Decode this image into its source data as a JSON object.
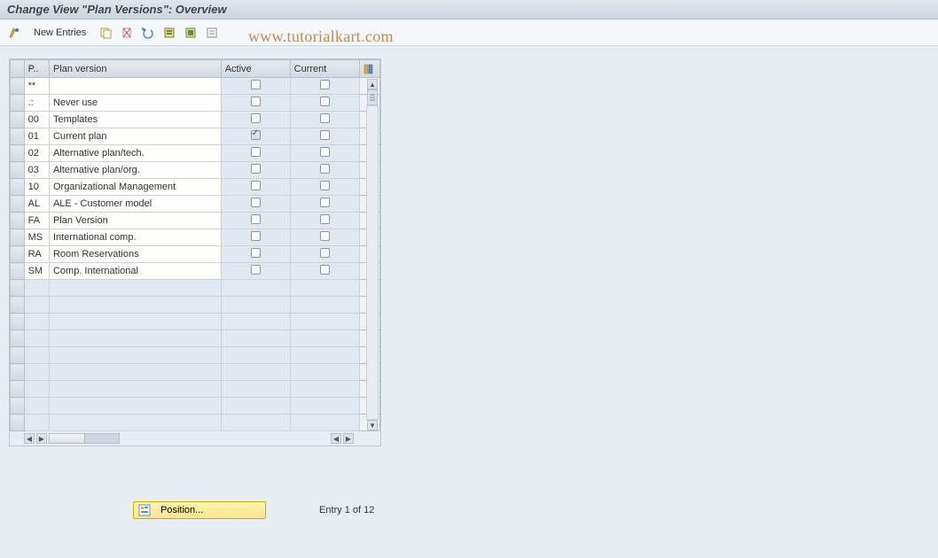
{
  "title": "Change View \"Plan Versions\": Overview",
  "toolbar": {
    "new_entries": "New Entries"
  },
  "watermark": "www.tutorialkart.com",
  "table": {
    "headers": {
      "code": "P..",
      "name": "Plan version",
      "active": "Active",
      "current": "Current"
    },
    "rows": [
      {
        "code": "**",
        "name": "",
        "active": false,
        "current": false
      },
      {
        "code": ".:",
        "name": "Never use",
        "active": false,
        "current": false
      },
      {
        "code": "00",
        "name": "Templates",
        "active": false,
        "current": false
      },
      {
        "code": "01",
        "name": "Current plan",
        "active": true,
        "current": false
      },
      {
        "code": "02",
        "name": "Alternative plan/tech.",
        "active": false,
        "current": false
      },
      {
        "code": "03",
        "name": "Alternative plan/org.",
        "active": false,
        "current": false
      },
      {
        "code": "10",
        "name": "Organizational Management",
        "active": false,
        "current": false
      },
      {
        "code": "AL",
        "name": "ALE - Customer model",
        "active": false,
        "current": false
      },
      {
        "code": "FA",
        "name": "Plan Version",
        "active": false,
        "current": false
      },
      {
        "code": "MS",
        "name": "International comp.",
        "active": false,
        "current": false
      },
      {
        "code": "RA",
        "name": "Room Reservations",
        "active": false,
        "current": false
      },
      {
        "code": "SM",
        "name": "Comp. International",
        "active": false,
        "current": false
      }
    ],
    "empty_rows": 9
  },
  "footer": {
    "position_label": "Position...",
    "entry_text": "Entry 1 of 12"
  }
}
